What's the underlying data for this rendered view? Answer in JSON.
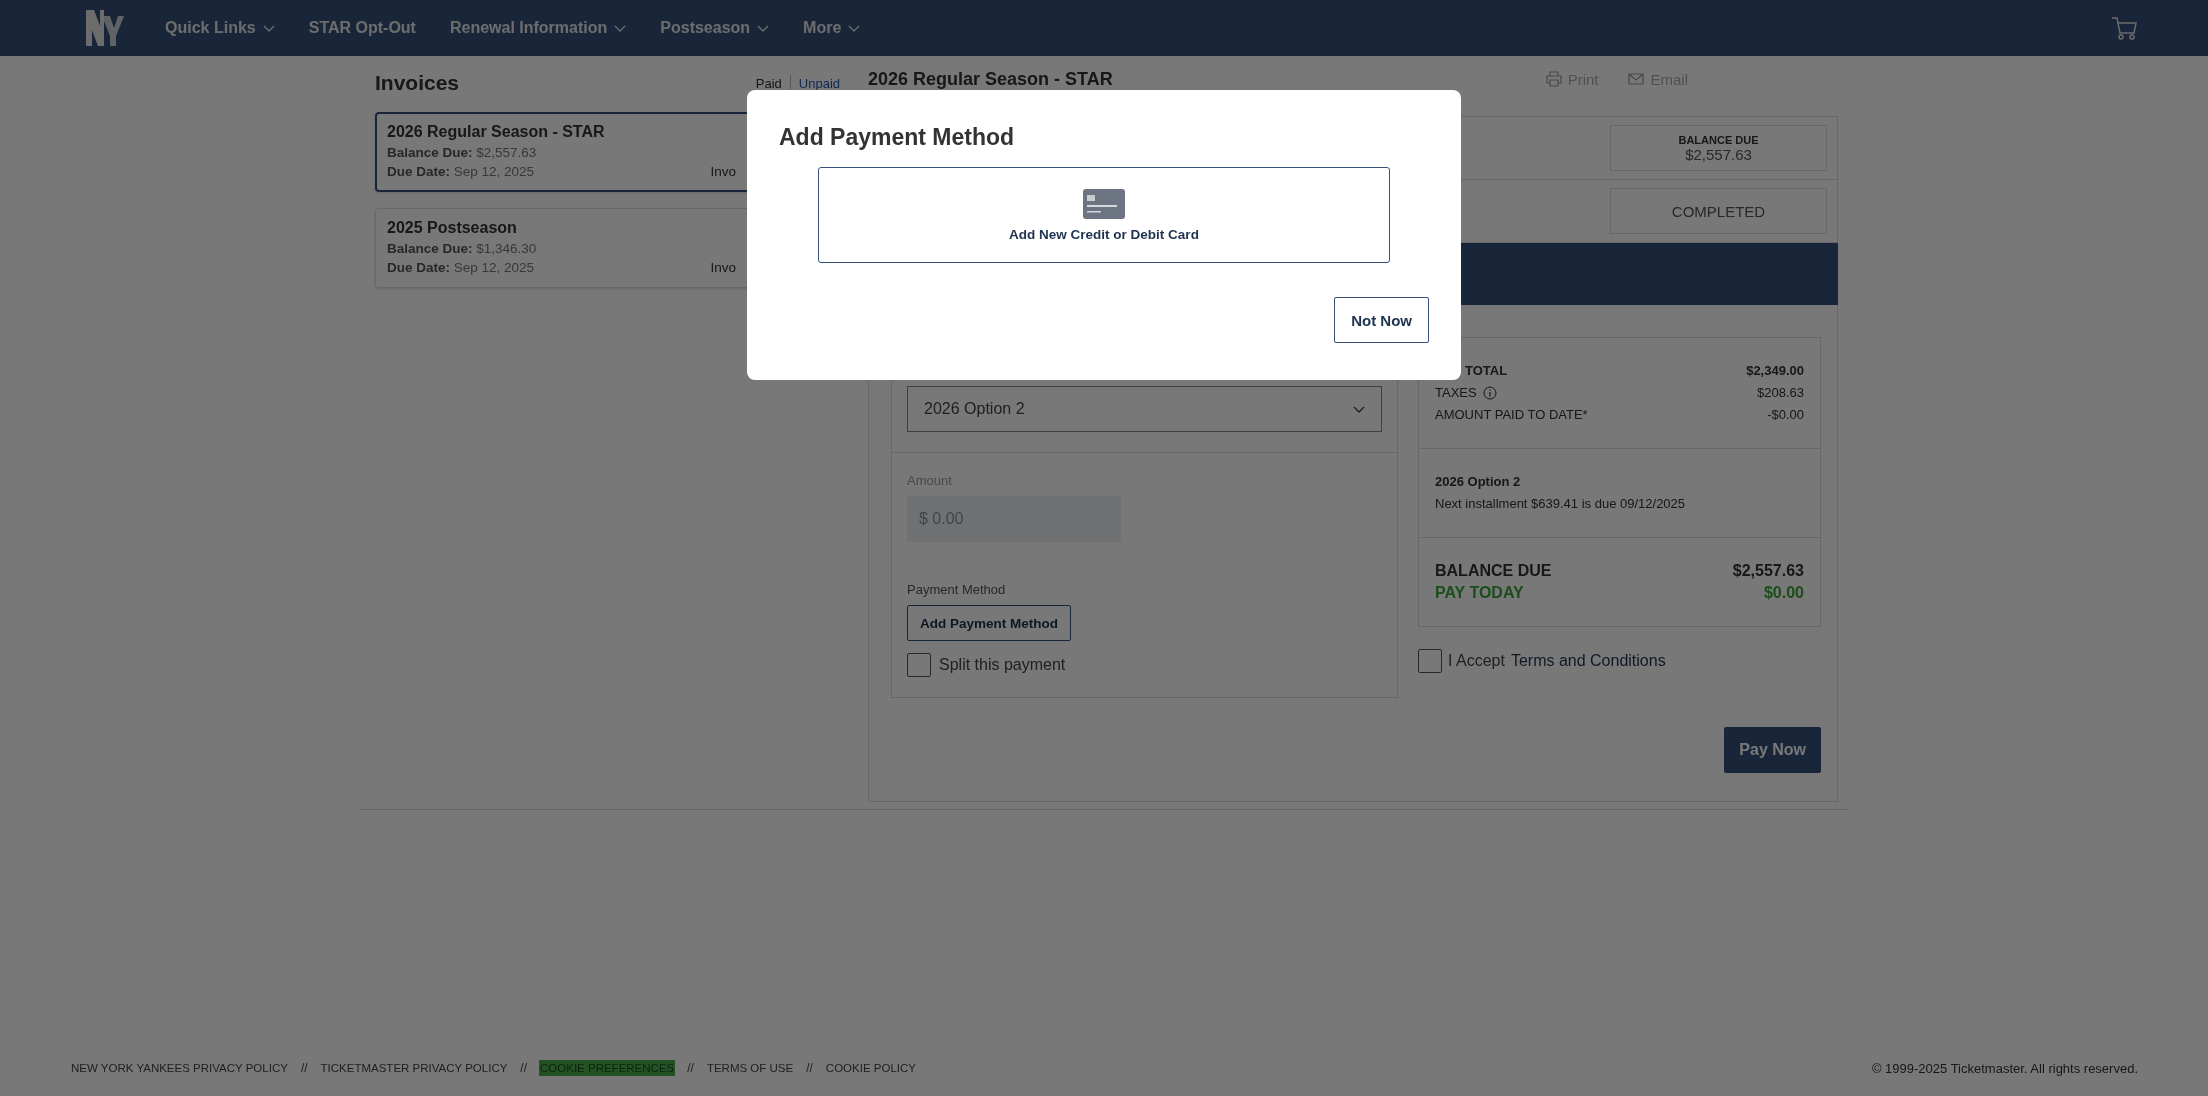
{
  "nav": {
    "items": [
      {
        "label": "Quick Links",
        "dropdown": true
      },
      {
        "label": "STAR Opt-Out",
        "dropdown": false
      },
      {
        "label": "Renewal Information",
        "dropdown": true
      },
      {
        "label": "Postseason",
        "dropdown": true
      },
      {
        "label": "More",
        "dropdown": true
      }
    ]
  },
  "invoices": {
    "title": "Invoices",
    "filters": [
      {
        "label": "Paid",
        "selected": false
      },
      {
        "label": "Unpaid",
        "selected": true
      }
    ],
    "items": [
      {
        "name": "2026 Regular Season - STAR",
        "balance_label": "Balance Due:",
        "balance": "$2,557.63",
        "due_label": "Due Date:",
        "due": "Sep 12, 2025",
        "column_3": "Invo",
        "selected": true
      },
      {
        "name": "2025 Postseason",
        "balance_label": "Balance Due:",
        "balance": "$1,346.30",
        "due_label": "Due Date:",
        "due": "Sep 12, 2025",
        "column_3": "Invo",
        "selected": false
      }
    ]
  },
  "detail": {
    "title": "2026 Regular Season - STAR",
    "actions": [
      {
        "kind": "print",
        "label": "Print"
      },
      {
        "kind": "email",
        "label": "Email"
      }
    ],
    "balance_due": {
      "label": "BALANCE DUE",
      "value": "$2,557.63"
    },
    "status": "COMPLETED",
    "plan_select": {
      "value": "2026 Option 2"
    },
    "amount": {
      "label": "Amount",
      "placeholder": "$ 0.00",
      "disabled": true
    },
    "payment_method": {
      "label": "Payment Method",
      "button": "Add Payment Method"
    },
    "split": {
      "label": "Split this payment",
      "checked": false
    },
    "summary": {
      "lines": [
        {
          "label": "TOTAL",
          "value": "$2,349.00",
          "kind": "bold",
          "info": false
        },
        {
          "label": "TAXES",
          "value": "$208.63",
          "kind": "plain",
          "info": true
        },
        {
          "label": "AMOUNT PAID TO DATE*",
          "value": "-$0.00",
          "kind": "plain",
          "info": false
        }
      ],
      "plan": {
        "name": "2026 Option 2",
        "note": "Next installment $639.41 is due 09/12/2025"
      },
      "totals": [
        {
          "label": "BALANCE DUE",
          "value": "$2,557.63",
          "kind": "balance"
        },
        {
          "label": "PAY TODAY",
          "value": "$0.00",
          "kind": "pay"
        }
      ]
    },
    "terms": {
      "label": "I Accept",
      "link": "Terms and Conditions",
      "checked": false
    },
    "pay_button": "Pay Now"
  },
  "footer": {
    "links": [
      {
        "label": "NEW YORK YANKEES PRIVACY POLICY",
        "highlighted": false
      },
      {
        "label": "TICKETMASTER PRIVACY POLICY",
        "highlighted": false
      },
      {
        "label": "COOKIE PREFERENCES",
        "highlighted": true
      },
      {
        "label": "TERMS OF USE",
        "highlighted": false
      },
      {
        "label": "COOKIE POLICY",
        "highlighted": false
      }
    ],
    "separators": [
      "//",
      "//",
      "//",
      "//"
    ],
    "copyright": "© 1999-2025 Ticketmaster. All rights reserved."
  },
  "modal": {
    "title": "Add Payment Method",
    "option": "Add New Credit or Debit Card",
    "button": "Not Now"
  }
}
